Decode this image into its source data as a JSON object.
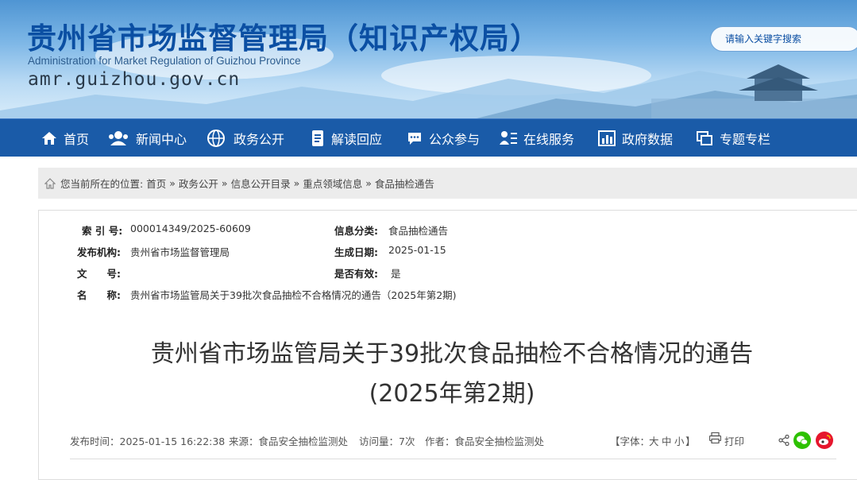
{
  "header": {
    "title": "贵州省市场监督管理局（知识产权局）",
    "title_en": "Administration for Market Regulation of Guizhou Province",
    "url": "amr.guizhou.gov.cn",
    "search_placeholder": "请输入关键字搜索"
  },
  "nav": {
    "items": [
      {
        "label": "首页",
        "icon": "home-icon"
      },
      {
        "label": "新闻中心",
        "icon": "people-icon"
      },
      {
        "label": "政务公开",
        "icon": "globe-icon"
      },
      {
        "label": "解读回应",
        "icon": "document-icon"
      },
      {
        "label": "公众参与",
        "icon": "chat-icon"
      },
      {
        "label": "在线服务",
        "icon": "user-list-icon"
      },
      {
        "label": "政府数据",
        "icon": "bar-chart-icon"
      },
      {
        "label": "专题专栏",
        "icon": "windows-icon"
      }
    ],
    "color": "#1a5ba8"
  },
  "breadcrumb": {
    "prefix": "您当前所在的位置:",
    "items": [
      "首页",
      "政务公开",
      "信息公开目录",
      "重点领域信息",
      "食品抽检通告"
    ],
    "separator": "»"
  },
  "meta": {
    "index_label": "索 引 号:",
    "index_value": "000014349/2025-60609",
    "category_label": "信息分类:",
    "category_value": "食品抽检通告",
    "publisher_label": "发布机构:",
    "publisher_value": "贵州省市场监督管理局",
    "date_label": "生成日期:",
    "date_value": "2025-01-15",
    "docno_label": "文　　号:",
    "docno_value": "",
    "valid_label": "是否有效:",
    "valid_value": "是",
    "name_label": "名　　称:",
    "name_value": "贵州省市场监管局关于39批次食品抽检不合格情况的通告（2025年第2期)"
  },
  "article": {
    "title_line1": "贵州省市场监管局关于39批次食品抽检不合格情况的通告",
    "title_line2": "(2025年第2期)",
    "publish_time": "发布时间：2025-01-15 16:22:38",
    "source": "来源：食品安全抽检监测处",
    "views": "访问量：7次",
    "author": "作者：食品安全抽检监测处",
    "font_size_label": "【字体：",
    "font_large": "大",
    "font_medium": "中",
    "font_small": "小",
    "font_size_end": "】",
    "print_label": "打印"
  },
  "share": {
    "wechat_color": "#2dc100",
    "weibo_color": "#e6162d"
  }
}
